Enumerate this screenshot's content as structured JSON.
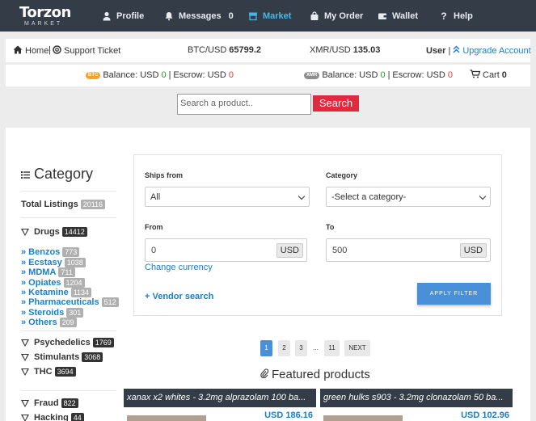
{
  "brand": {
    "logo_word": "Torzon",
    "logo_sub": "MARKET"
  },
  "nav": [
    {
      "label": "Profile",
      "icon": "user-icon"
    },
    {
      "label": "Messages",
      "icon": "bell-icon",
      "count": "0"
    },
    {
      "label": "Market",
      "icon": "store-icon",
      "active": true
    },
    {
      "label": "My Order",
      "icon": "bag-icon"
    },
    {
      "label": "Wallet",
      "icon": "wallet-icon"
    },
    {
      "label": "Help",
      "icon": "question-icon"
    }
  ],
  "infobar": {
    "home": "Home",
    "support": "Support Ticket",
    "btc_label": "BTC/USD",
    "btc_value": "65799.2",
    "xmr_label": "XMR/USD",
    "xmr_value": "135.03",
    "user": "User",
    "upgrade": "Upgrade Account"
  },
  "balances": {
    "btc_tag": "BTC",
    "btc_balance_label": "Balance: USD",
    "btc_balance": "0",
    "btc_escrow_label": "Escrow: USD",
    "btc_escrow": "0",
    "xmr_tag": "XMR",
    "xmr_balance_label": "Balance: USD",
    "xmr_balance": "0",
    "xmr_escrow_label": "Escrow: USD",
    "xmr_escrow": "0",
    "cart_label": "Cart",
    "cart_count": "0"
  },
  "search": {
    "placeholder": "Search a product..",
    "button": "Search"
  },
  "category": {
    "title": "Category",
    "total_label": "Total Listings",
    "total": "20116",
    "groups": [
      {
        "label": "Drugs",
        "count": "14412"
      },
      {
        "label": "Psychedelics",
        "count": "1769"
      },
      {
        "label": "Stimulants",
        "count": "3068"
      },
      {
        "label": "THC",
        "count": "3694"
      },
      {
        "label": "Fraud",
        "count": "822"
      },
      {
        "label": "Hacking",
        "count": "44"
      }
    ],
    "drugs_sub": [
      {
        "label": "» Benzos",
        "count": "773"
      },
      {
        "label": "» Ecstasy",
        "count": "1038"
      },
      {
        "label": "» MDMA",
        "count": "711"
      },
      {
        "label": "» Opiates",
        "count": "1204"
      },
      {
        "label": "» Ketamine",
        "count": "1134"
      },
      {
        "label": "» Pharmaceuticals",
        "count": "512"
      },
      {
        "label": "» Steroids",
        "count": "301"
      },
      {
        "label": "» Others",
        "count": "209"
      }
    ]
  },
  "filter": {
    "ships_from_label": "Ships from",
    "ships_from_value": "All",
    "category_label": "Category",
    "category_value": "-Select a category-",
    "from_label": "From",
    "from_value": "0",
    "from_unit": "USD",
    "to_label": "To",
    "to_value": "500",
    "to_unit": "USD",
    "change_currency": "Change currency",
    "vendor_search": "+ Vendor search",
    "apply": "APPLY FILTER"
  },
  "pagination": {
    "pages": [
      "1",
      "2",
      "3",
      "...",
      "11",
      "NEXT"
    ],
    "current": "1"
  },
  "featured": {
    "title": "Featured products",
    "items": [
      {
        "title": "xanax x2 whites - 3.2mg alprazolam 100 ba...",
        "price": "USD 186.16"
      },
      {
        "title": "green hulks s903 - 3.2mg clonazolam 50 ba...",
        "price": "USD 102.96"
      }
    ]
  }
}
